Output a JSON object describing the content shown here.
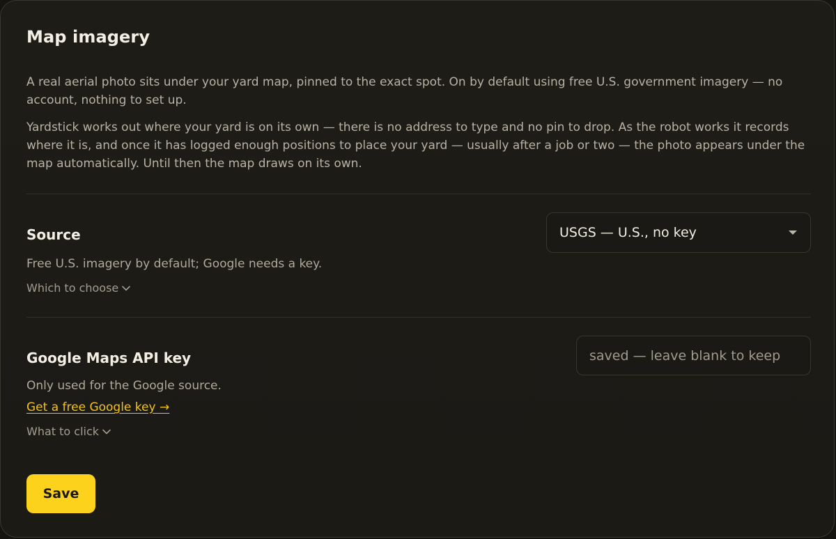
{
  "page": {
    "title": "Map imagery",
    "intro": [
      "A real aerial photo sits under your yard map, pinned to the exact spot. On by default using free U.S. government imagery — no account, nothing to set up.",
      "Yardstick works out where your yard is on its own — there is no address to type and no pin to drop. As the robot works it records where it is, and once it has logged enough positions to place your yard — usually after a job or two — the photo appears under the map automatically. Until then the map draws on its own."
    ]
  },
  "source": {
    "title": "Source",
    "description": "Free U.S. imagery by default; Google needs a key.",
    "help_toggle": "Which to choose",
    "select_value": "USGS — U.S., no key",
    "dropdown_icon": "caret-down-icon"
  },
  "google_key": {
    "title": "Google Maps API key",
    "description": "Only used for the Google source.",
    "link_label": "Get a free Google key →",
    "help_toggle": "What to click",
    "input_value": "",
    "input_placeholder": "saved — leave blank to keep"
  },
  "actions": {
    "save_label": "Save"
  },
  "colors": {
    "accent": "#fcd21c",
    "link": "#f1c21b",
    "background": "#1e1c17"
  }
}
